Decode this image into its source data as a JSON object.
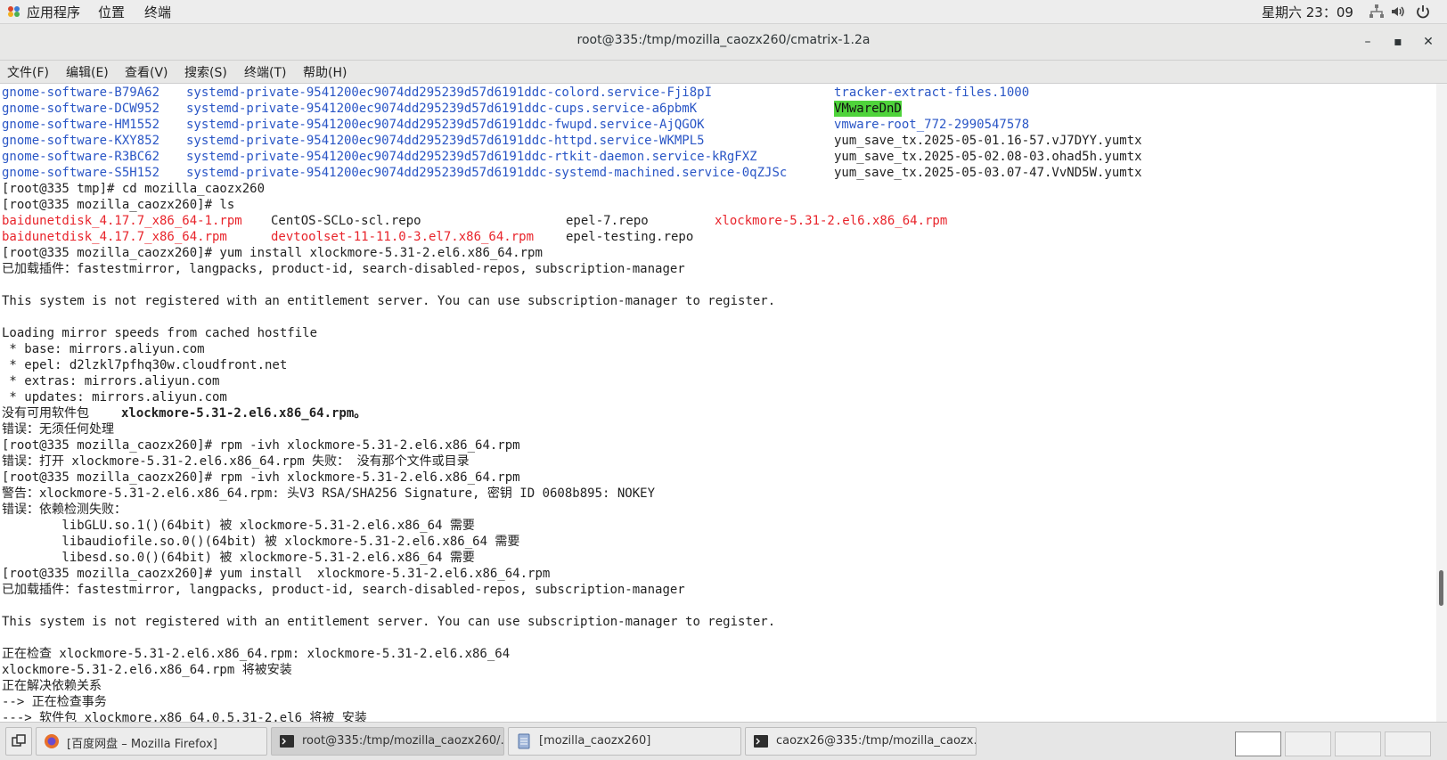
{
  "top_panel": {
    "applications": "应用程序",
    "places": "位置",
    "terminal": "终端",
    "clock": "星期六 23：09",
    "tray_icons": [
      "network-icon",
      "volume-icon",
      "power-icon"
    ]
  },
  "window": {
    "title": "root@335:/tmp/mozilla_caozx260/cmatrix-1.2a",
    "minimize": "–",
    "maximize": "▪",
    "close": "✕"
  },
  "menubar": [
    "文件(F)",
    "编辑(E)",
    "查看(V)",
    "搜索(S)",
    "终端(T)",
    "帮助(H)"
  ],
  "terminal": {
    "colors": {
      "blue": "#2a56c6",
      "red": "#e8242b",
      "highlight": "#4fd33b"
    },
    "lines": [
      {
        "cols": [
          {
            "t": "gnome-software-B79A62",
            "c": "b"
          },
          {
            "t": "systemd-private-9541200ec9074dd295239d57d6191ddc-colord.service-Fji8pI",
            "c": "b"
          },
          {
            "t": "tracker-extract-files.1000",
            "c": "b"
          }
        ]
      },
      {
        "cols": [
          {
            "t": "gnome-software-DCW952",
            "c": "b"
          },
          {
            "t": "systemd-private-9541200ec9074dd295239d57d6191ddc-cups.service-a6pbmK",
            "c": "b"
          },
          {
            "t": "VMwareDnD",
            "c": "hl"
          }
        ]
      },
      {
        "cols": [
          {
            "t": "gnome-software-HM1552",
            "c": "b"
          },
          {
            "t": "systemd-private-9541200ec9074dd295239d57d6191ddc-fwupd.service-AjQGOK",
            "c": "b"
          },
          {
            "t": "vmware-root_772-2990547578",
            "c": "b"
          }
        ]
      },
      {
        "cols": [
          {
            "t": "gnome-software-KXY852",
            "c": "b"
          },
          {
            "t": "systemd-private-9541200ec9074dd295239d57d6191ddc-httpd.service-WKMPL5",
            "c": "b"
          },
          {
            "t": "yum_save_tx.2025-05-01.16-57.vJ7DYY.yumtx",
            "c": ""
          }
        ]
      },
      {
        "cols": [
          {
            "t": "gnome-software-R3BC62",
            "c": "b"
          },
          {
            "t": "systemd-private-9541200ec9074dd295239d57d6191ddc-rtkit-daemon.service-kRgFXZ",
            "c": "b"
          },
          {
            "t": "yum_save_tx.2025-05-02.08-03.ohad5h.yumtx",
            "c": ""
          }
        ]
      },
      {
        "cols": [
          {
            "t": "gnome-software-S5H152",
            "c": "b"
          },
          {
            "t": "systemd-private-9541200ec9074dd295239d57d6191ddc-systemd-machined.service-0qZJSc",
            "c": "b"
          },
          {
            "t": "yum_save_tx.2025-05-03.07-47.VvND5W.yumtx",
            "c": ""
          }
        ]
      },
      {
        "text": "[root@335 tmp]# cd mozilla_caozx260"
      },
      {
        "text": "[root@335 mozilla_caozx260]# ls"
      },
      {
        "cols": [
          {
            "t": "baidunetdisk_4.17.7_x86_64-1.rpm",
            "c": "r"
          },
          {
            "t": "CentOS-SCLo-scl.repo",
            "c": ""
          },
          {
            "t": "epel-7.repo",
            "c": ""
          },
          {
            "t": "xlockmore-5.31-2.el6.x86_64.rpm",
            "c": "r"
          }
        ]
      },
      {
        "cols": [
          {
            "t": "baidunetdisk_4.17.7_x86_64.rpm",
            "c": "r"
          },
          {
            "t": "devtoolset-11-11.0-3.el7.x86_64.rpm",
            "c": "r"
          },
          {
            "t": "epel-testing.repo",
            "c": ""
          }
        ]
      },
      {
        "text": "[root@335 mozilla_caozx260]# yum install xlockmore-5.31-2.el6.x86_64.rpm"
      },
      {
        "text": "已加载插件：fastestmirror, langpacks, product-id, search-disabled-repos, subscription-manager"
      },
      {
        "text": ""
      },
      {
        "text": "This system is not registered with an entitlement server. You can use subscription-manager to register."
      },
      {
        "text": ""
      },
      {
        "text": "Loading mirror speeds from cached hostfile"
      },
      {
        "text": " * base: mirrors.aliyun.com"
      },
      {
        "text": " * epel: d2lzkl7pfhq30w.cloudfront.net"
      },
      {
        "text": " * extras: mirrors.aliyun.com"
      },
      {
        "text": " * updates: mirrors.aliyun.com"
      },
      {
        "cols": [
          {
            "t": "没有可用软件包 ",
            "c": ""
          },
          {
            "t": "xlockmore-5.31-2.el6.x86_64.rpm。",
            "c": "bold"
          }
        ]
      },
      {
        "text": "错误：无须任何处理"
      },
      {
        "text": "[root@335 mozilla_caozx260]# rpm -ivh xlockmore-5.31-2.el6.x86_64.rpm"
      },
      {
        "text": "错误：打开 xlockmore-5.31-2.el6.x86_64.rpm 失败： 没有那个文件或目录"
      },
      {
        "text": "[root@335 mozilla_caozx260]# rpm -ivh xlockmore-5.31-2.el6.x86_64.rpm"
      },
      {
        "text": "警告：xlockmore-5.31-2.el6.x86_64.rpm: 头V3 RSA/SHA256 Signature, 密钥 ID 0608b895: NOKEY"
      },
      {
        "text": "错误：依赖检测失败："
      },
      {
        "text": "        libGLU.so.1()(64bit) 被 xlockmore-5.31-2.el6.x86_64 需要"
      },
      {
        "text": "        libaudiofile.so.0()(64bit) 被 xlockmore-5.31-2.el6.x86_64 需要"
      },
      {
        "text": "        libesd.so.0()(64bit) 被 xlockmore-5.31-2.el6.x86_64 需要"
      },
      {
        "text": "[root@335 mozilla_caozx260]# yum install  xlockmore-5.31-2.el6.x86_64.rpm"
      },
      {
        "text": "已加载插件：fastestmirror, langpacks, product-id, search-disabled-repos, subscription-manager"
      },
      {
        "text": ""
      },
      {
        "text": "This system is not registered with an entitlement server. You can use subscription-manager to register."
      },
      {
        "text": ""
      },
      {
        "text": "正在检查 xlockmore-5.31-2.el6.x86_64.rpm: xlockmore-5.31-2.el6.x86_64"
      },
      {
        "text": "xlockmore-5.31-2.el6.x86_64.rpm 将被安装"
      },
      {
        "text": "正在解决依赖关系"
      },
      {
        "text": "--> 正在检查事务"
      },
      {
        "text": "---> 软件包 xlockmore.x86_64.0.5.31-2.el6 将被 安装"
      }
    ]
  },
  "taskbar": {
    "tasks": [
      {
        "label": "[百度网盘 – Mozilla Firefox]",
        "icon": "firefox-icon",
        "active": false
      },
      {
        "label": "root@335:/tmp/mozilla_caozx260/…",
        "icon": "terminal-icon",
        "active": true
      },
      {
        "label": "[mozilla_caozx260]",
        "icon": "file-manager-icon",
        "active": false
      },
      {
        "label": "caozx26@335:/tmp/mozilla_caozx…",
        "icon": "terminal-icon",
        "active": false
      }
    ],
    "workspaces": 4,
    "active_workspace": 1
  }
}
